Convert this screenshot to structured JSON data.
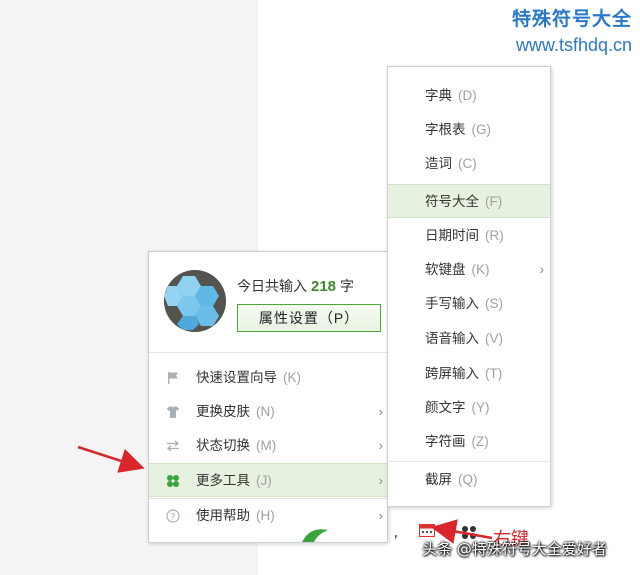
{
  "brand": {
    "title": "特殊符号大全",
    "url": "www.tsfhdq.cn"
  },
  "menu": {
    "today_prefix": "今日共输入",
    "today_count": "218",
    "today_suffix": "字",
    "prop_button": "属性设置（P）",
    "items": [
      {
        "label": "快速设置向导",
        "key": "(K)",
        "icon": "flag-icon",
        "has_arrow": false
      },
      {
        "label": "更换皮肤",
        "key": "(N)",
        "icon": "shirt-icon",
        "has_arrow": true
      },
      {
        "label": "状态切换",
        "key": "(M)",
        "icon": "switch-arrows-icon",
        "has_arrow": true
      },
      {
        "label": "更多工具",
        "key": "(J)",
        "icon": "clover-icon",
        "has_arrow": true,
        "active": true
      },
      {
        "label": "使用帮助",
        "key": "(H)",
        "icon": "help-circle-icon",
        "has_arrow": true
      }
    ]
  },
  "submenu": {
    "items": [
      {
        "label": "字典",
        "key": "(D)"
      },
      {
        "label": "字根表",
        "key": "(G)"
      },
      {
        "label": "造词",
        "key": "(C)"
      },
      {
        "label": "符号大全",
        "key": "(F)",
        "active": true
      },
      {
        "label": "日期时间",
        "key": "(R)"
      },
      {
        "label": "软键盘",
        "key": "(K)",
        "has_arrow": true
      },
      {
        "label": "手写输入",
        "key": "(S)"
      },
      {
        "label": "语音输入",
        "key": "(V)"
      },
      {
        "label": "跨屏输入",
        "key": "(T)"
      },
      {
        "label": "颜文字",
        "key": "(Y)"
      },
      {
        "label": "字符画",
        "key": "(Z)"
      },
      {
        "label": "截屏",
        "key": "(Q)"
      }
    ]
  },
  "annotation": {
    "right_click_label": "右键"
  },
  "footer": {
    "watermark": "头条 @特殊符号大全爱好者"
  },
  "colors": {
    "accent_green": "#3a8a2a",
    "active_bg": "#e6f2df",
    "brand_blue": "#2a78c9",
    "annotation_red": "#d8262a"
  }
}
